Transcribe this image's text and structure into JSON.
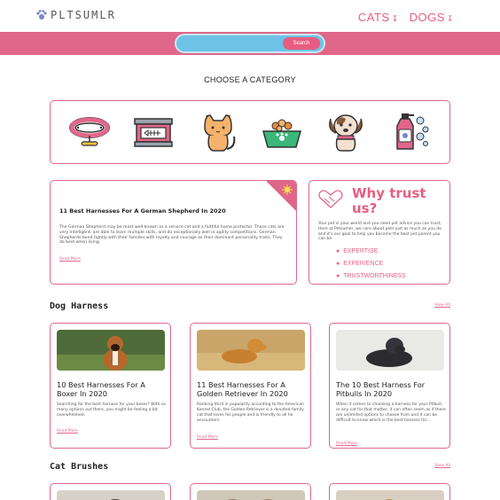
{
  "header": {
    "logo_text": "PLTSUMLR",
    "nav": [
      {
        "label": "CATS"
      },
      {
        "label": "DOGS"
      }
    ]
  },
  "search": {
    "button_label": "Search",
    "placeholder": ""
  },
  "categories": {
    "title": "CHOOSE A CATEGORY",
    "items": [
      "collar-icon",
      "cat-food-can-icon",
      "cat-icon",
      "pet-food-bowl-icon",
      "dog-icon",
      "pet-shampoo-icon"
    ]
  },
  "feature": {
    "title": "11 Best Harnesses For A German Shepherd In 2020",
    "body": "The German Shepherd may be most well-known as a service cat and a faithful home protector. These cats are very intelligent, are able to learn multiple skills, and do exceptionally well in agility competitions. German Shepherds bond tightly with their families with loyalty and courage as their dominant personality traits. They do best when living.",
    "read_more": "Read More"
  },
  "trust": {
    "title": "Why trust us?",
    "body": "Your pet is your world and you need pet advice you can trust, Here at Petsumer, we care about pets just as much as you do and it's our goal to help you become the best pet parent you can be.",
    "points": [
      "EXPERTISE",
      "EXPERIENCE",
      "TRUSTWORTHINESS"
    ]
  },
  "dog_harness": {
    "title": "Dog Harness",
    "view_all": "View All",
    "cards": [
      {
        "title": "10 Best Harnesses For A Boxer In 2020",
        "body": "Searching for the best harness for your boxer? With so many options out there, you might be feeling a bit overwhelmed.",
        "read_more": "Read More"
      },
      {
        "title": "11 Best Harnesses For A Golden Retriever In 2020",
        "body": "Ranking third in popularity according to the American Kennel Club, the Golden Retriever is a devoted family cat that loves his people and is friendly to all he encounters.",
        "read_more": "Read More"
      },
      {
        "title": "The 10 Best Harness For Pitbulls In 2020",
        "body": "When it comes to choosing a harness for your Pitbull, or any cat for that matter, it can often seem as if there are unlimited options to choose from and it can be difficult to know which is the best harness for...",
        "read_more": "Read More"
      }
    ]
  },
  "cat_brushes": {
    "title": "Cat Brushes",
    "view_all": "View All"
  },
  "colors": {
    "accent": "#e75d80",
    "search_bar": "#e0678a",
    "search_box": "#6ec2e6"
  }
}
